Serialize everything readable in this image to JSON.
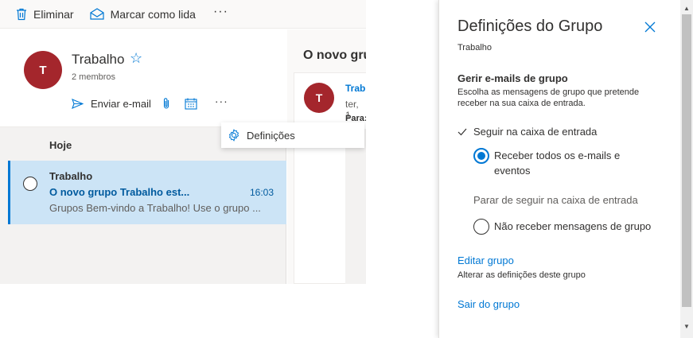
{
  "toolbar": {
    "delete_label": "Eliminar",
    "mark_read_label": "Marcar como lida",
    "more_label": "···"
  },
  "group": {
    "avatar_initial": "T",
    "name": "Trabalho",
    "members": "2 membros",
    "send_email_label": "Enviar e-mail",
    "more_label": "···"
  },
  "list": {
    "section_label": "Hoje",
    "items": [
      {
        "from": "Trabalho",
        "subject": "O novo grupo Trabalho est...",
        "time": "16:03",
        "preview": "Grupos Bem-vindo a Trabalho! Use o grupo ..."
      }
    ]
  },
  "reading": {
    "title": "O novo gru",
    "avatar_initial": "T",
    "from": "Trab",
    "date": "ter, 1",
    "to": "Para:"
  },
  "dropdown": {
    "settings_label": "Definições"
  },
  "panel": {
    "title": "Definições do Grupo",
    "subtitle": "Trabalho",
    "manage_heading": "Gerir e-mails de grupo",
    "manage_desc": "Escolha as mensagens de grupo que pretende receber na sua caixa de entrada.",
    "follow_label": "Seguir na caixa de entrada",
    "receive_all_label": "Receber todos os e-mails e eventos",
    "stop_follow_label": "Parar de seguir na caixa de entrada",
    "no_messages_label": "Não receber mensagens de grupo",
    "edit_link": "Editar grupo",
    "edit_desc": "Alterar as definições deste grupo",
    "leave_link": "Sair do grupo",
    "follow_checked": true,
    "receive_all_selected": true,
    "no_messages_selected": false
  },
  "colors": {
    "accent": "#0078d4",
    "avatar": "#a4262c",
    "selected_bg": "#cce4f6"
  }
}
